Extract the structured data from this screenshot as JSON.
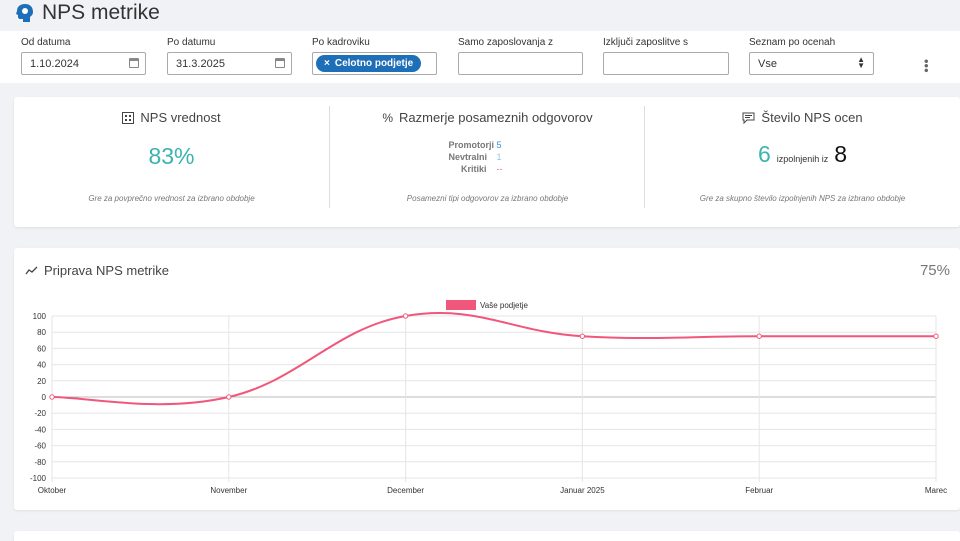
{
  "page": {
    "title": "NPS metrike"
  },
  "filters": {
    "od_datuma": {
      "label": "Od datuma",
      "value": "1.10.2024"
    },
    "po_datumu": {
      "label": "Po datumu",
      "value": "31.3.2025"
    },
    "po_kadroviku": {
      "label": "Po kadroviku",
      "tag": "Celotno podjetje",
      "tag_remove": "×"
    },
    "samo_zaposlovanja": {
      "label": "Samo zaposlovanja z",
      "value": ""
    },
    "izkljuci": {
      "label": "Izključi zaposlitve s",
      "value": ""
    },
    "seznam": {
      "label": "Seznam po ocenah",
      "value": "Vse"
    }
  },
  "stats": {
    "nps": {
      "title": "NPS vrednost",
      "value": "83%",
      "desc": "Gre za povprečno vrednost za izbrano obdobje"
    },
    "ratio": {
      "title": "Razmerje posameznih odgovorov",
      "rows": [
        {
          "label": "Promotorji",
          "value": "5",
          "color": "#3a8fd9"
        },
        {
          "label": "Nevtralni",
          "value": "1",
          "color": "#8fc8e8"
        },
        {
          "label": "Kritiki",
          "value": "--",
          "color": "#e57373"
        }
      ],
      "desc": "Posamezni tipi odgovorov za izbrano obdobje"
    },
    "count": {
      "title": "Število NPS ocen",
      "filled": "6",
      "of_label": "izpolnjenih iz",
      "total": "8",
      "desc": "Gre za skupno število izpolnjenih NPS za izbrano obdobje"
    }
  },
  "chart_section": {
    "title": "Priprava NPS metrike",
    "percent": "75%"
  },
  "chart_data": {
    "type": "line",
    "categories": [
      "Oktober",
      "November",
      "December",
      "Januar 2025",
      "Februar",
      "Marec"
    ],
    "series": [
      {
        "name": "Vaše podjetje",
        "values": [
          0,
          0,
          100,
          75,
          75,
          75
        ],
        "color": "#f0577a"
      }
    ],
    "ylim": [
      -100,
      100
    ],
    "yticks": [
      100,
      80,
      60,
      40,
      20,
      0,
      -20,
      -40,
      -60,
      -80,
      -100
    ],
    "grid": true,
    "legend": "top"
  }
}
